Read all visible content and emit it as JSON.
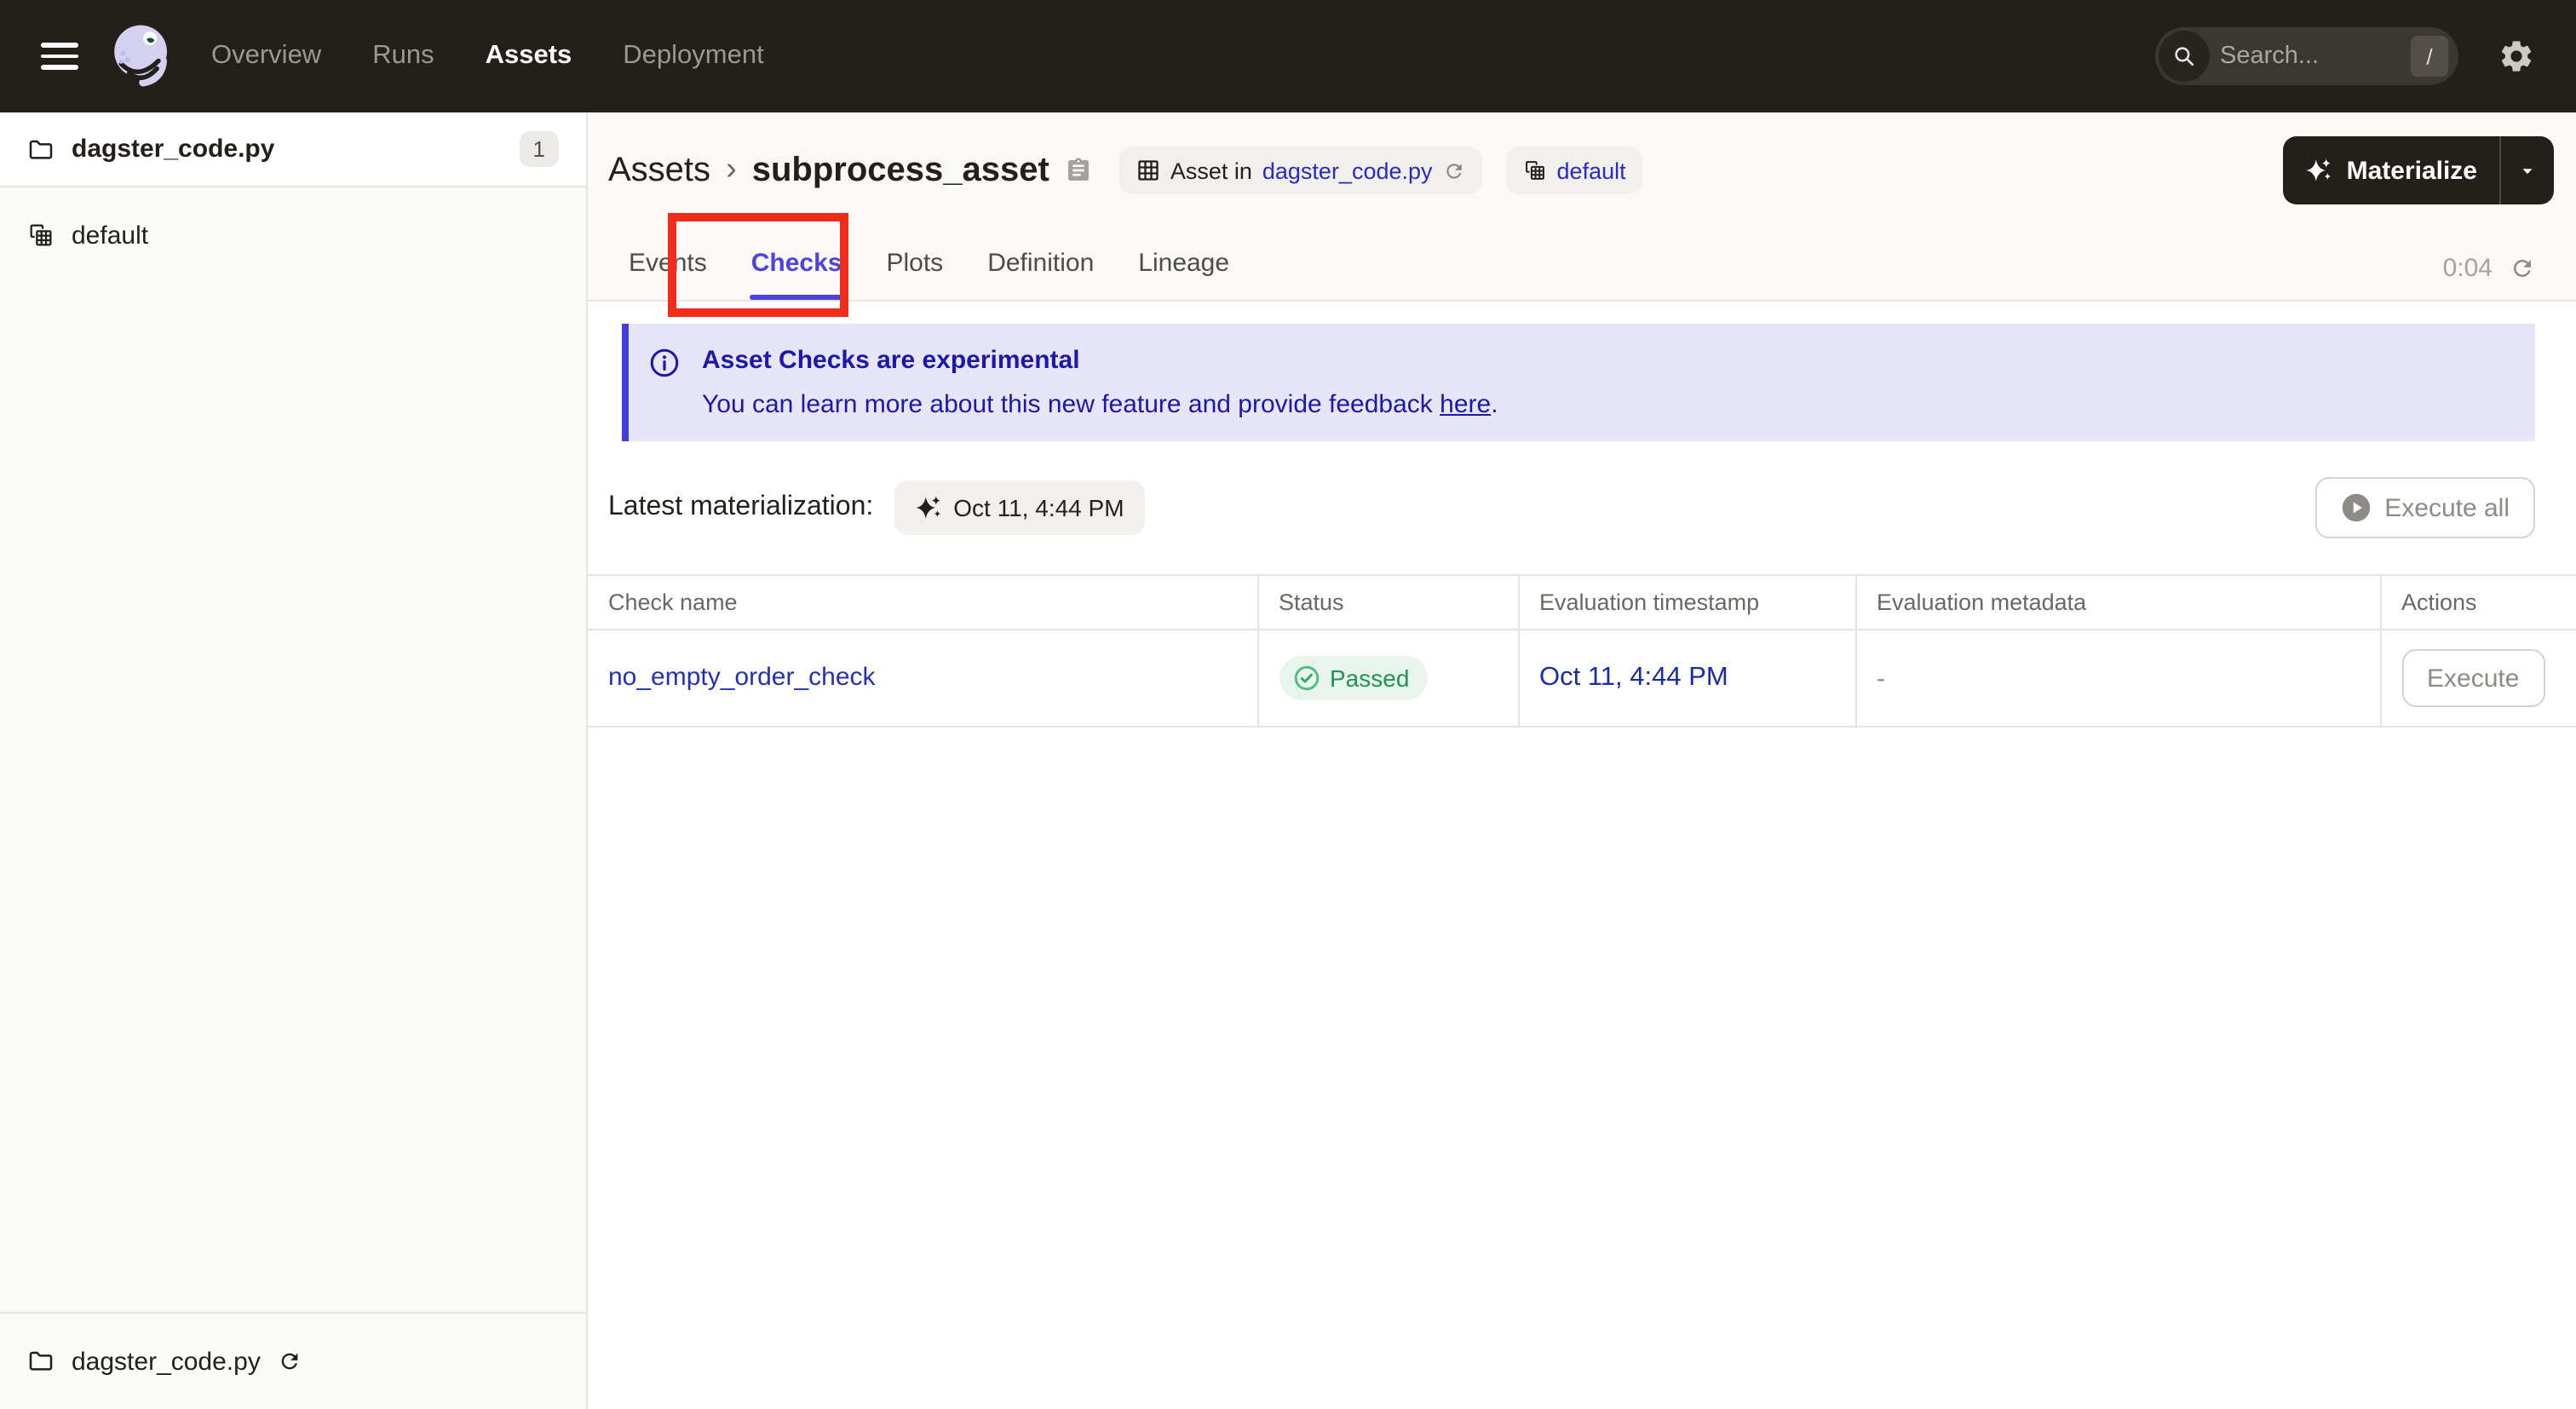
{
  "colors": {
    "topbar_bg": "#231F1B",
    "accent_purple": "#4F43DD",
    "banner_text": "#1D18AB",
    "link_blue": "#2430B5",
    "success_green": "#1F9450",
    "annotation_red": "#EE2E1A"
  },
  "topbar": {
    "nav_items": [
      {
        "label": "Overview"
      },
      {
        "label": "Runs"
      },
      {
        "label": "Assets"
      },
      {
        "label": "Deployment"
      }
    ],
    "search": {
      "placeholder": "Search...",
      "shortcut": "/"
    }
  },
  "sidebar": {
    "group_header": {
      "label": "dagster_code.py",
      "count": "1"
    },
    "items": [
      {
        "label": "default"
      }
    ],
    "footer": {
      "label": "dagster_code.py"
    }
  },
  "header": {
    "breadcrumb": {
      "root": "Assets",
      "separator": "›",
      "current": "subprocess_asset"
    },
    "asset_badge": {
      "prefix": "Asset in",
      "link": "dagster_code.py"
    },
    "group_badge": {
      "label": "default"
    },
    "materialize_label": "Materialize"
  },
  "tabs": {
    "items": [
      {
        "label": "Events"
      },
      {
        "label": "Checks"
      },
      {
        "label": "Plots"
      },
      {
        "label": "Definition"
      },
      {
        "label": "Lineage"
      }
    ],
    "timer": "0:04"
  },
  "banner": {
    "title": "Asset Checks are experimental",
    "body": "You can learn more about this new feature and provide feedback ",
    "link_text": "here",
    "period": "."
  },
  "latest": {
    "label": "Latest materialization:",
    "timestamp": "Oct 11, 4:44 PM"
  },
  "toolbar": {
    "execute_all_label": "Execute all"
  },
  "table": {
    "columns": [
      {
        "label": "Check name"
      },
      {
        "label": "Status"
      },
      {
        "label": "Evaluation timestamp"
      },
      {
        "label": "Evaluation metadata"
      },
      {
        "label": "Actions"
      }
    ],
    "rows": [
      {
        "name": "no_empty_order_check",
        "status": "Passed",
        "timestamp": "Oct 11, 4:44 PM",
        "metadata": "-",
        "action_label": "Execute"
      }
    ]
  }
}
